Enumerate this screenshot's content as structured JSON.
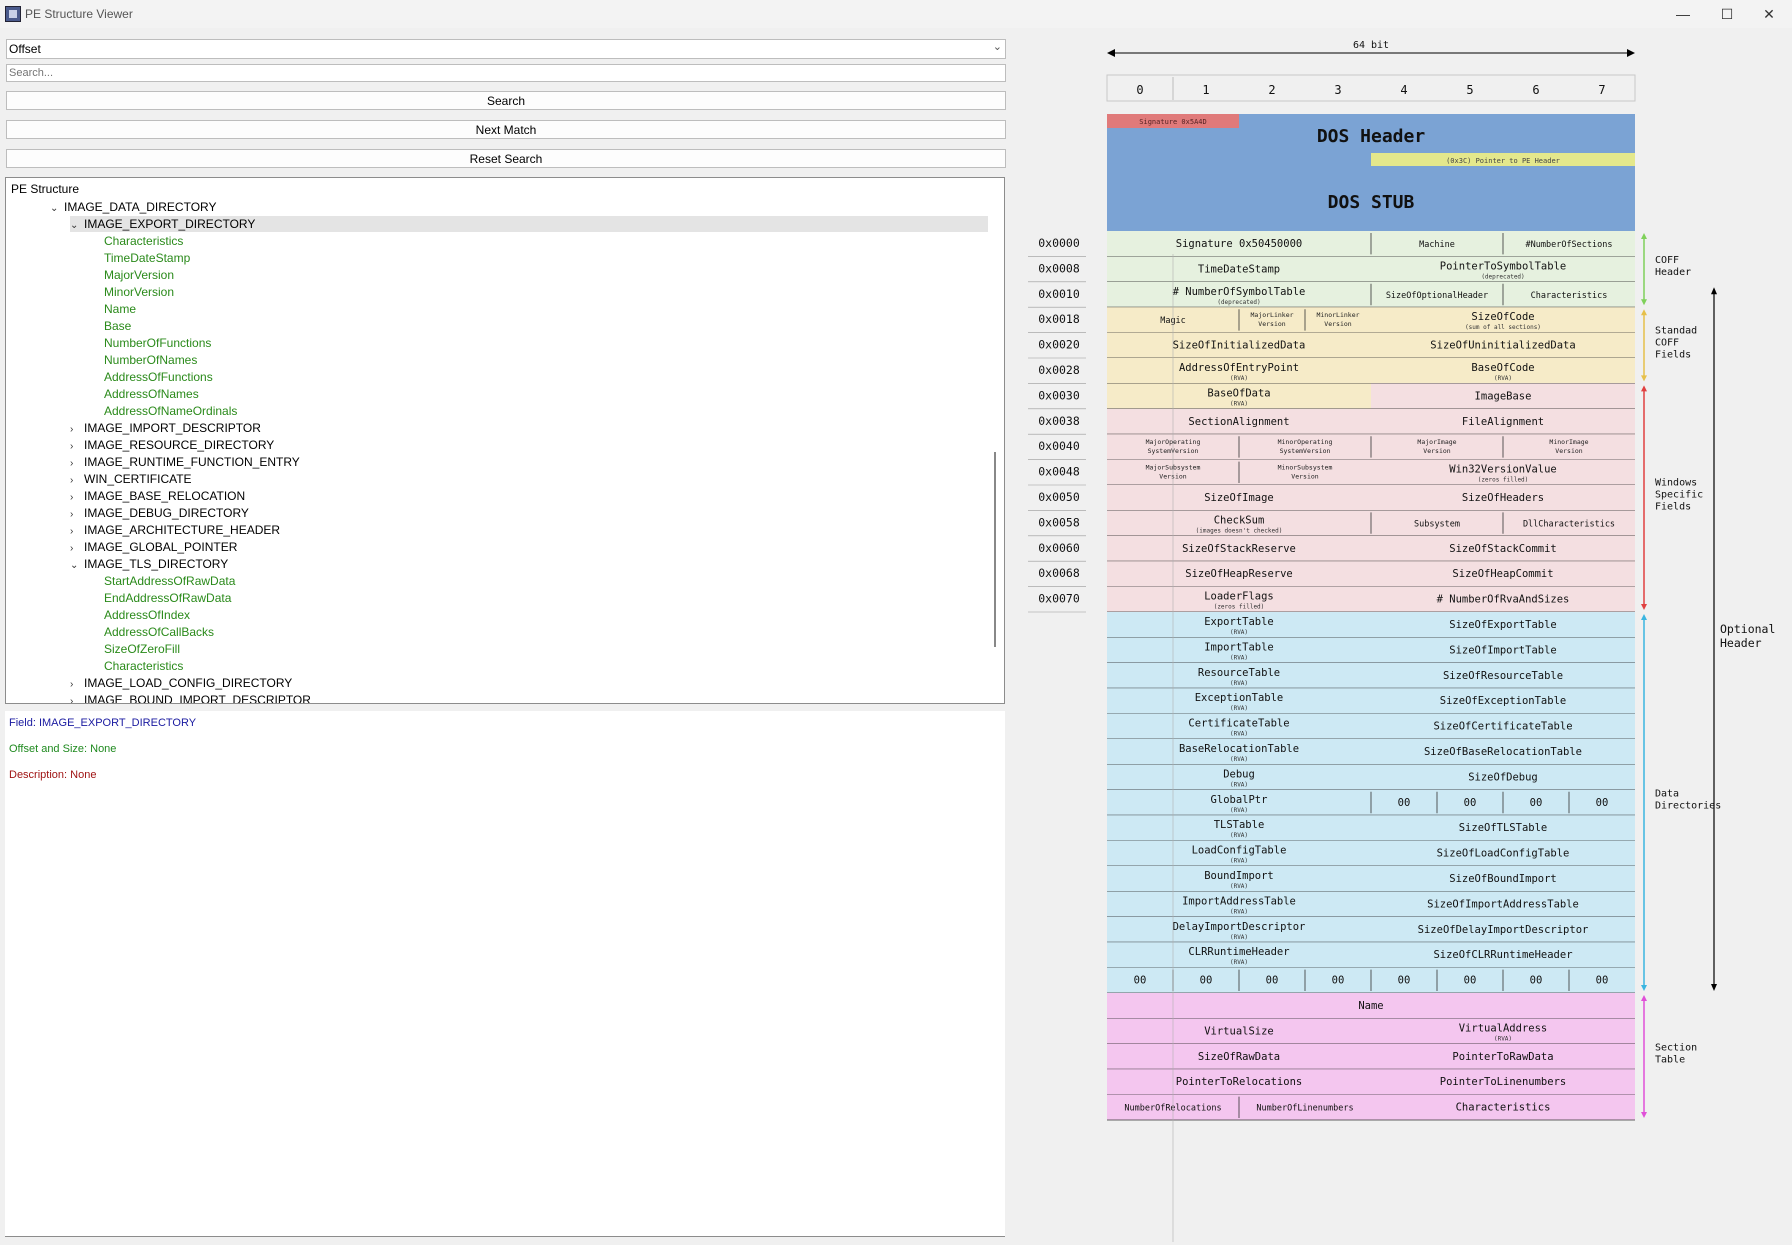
{
  "window": {
    "title": "PE Structure Viewer",
    "minimize": "—",
    "maximize": "☐",
    "close": "✕"
  },
  "combo": {
    "value": "Offset"
  },
  "search": {
    "placeholder": "Search...",
    "search_label": "Search",
    "next_label": "Next Match",
    "reset_label": "Reset Search"
  },
  "tree": {
    "root": "PE Structure",
    "rows": [
      {
        "label": "IMAGE_DATA_DIRECTORY",
        "level": 1,
        "arrow": "⌄",
        "leaf": false
      },
      {
        "label": "IMAGE_EXPORT_DIRECTORY",
        "level": 2,
        "arrow": "⌄",
        "leaf": false,
        "selected": true
      },
      {
        "label": "Characteristics",
        "level": 3,
        "arrow": "",
        "leaf": true
      },
      {
        "label": "TimeDateStamp",
        "level": 3,
        "arrow": "",
        "leaf": true
      },
      {
        "label": "MajorVersion",
        "level": 3,
        "arrow": "",
        "leaf": true
      },
      {
        "label": "MinorVersion",
        "level": 3,
        "arrow": "",
        "leaf": true
      },
      {
        "label": "Name",
        "level": 3,
        "arrow": "",
        "leaf": true
      },
      {
        "label": "Base",
        "level": 3,
        "arrow": "",
        "leaf": true
      },
      {
        "label": "NumberOfFunctions",
        "level": 3,
        "arrow": "",
        "leaf": true
      },
      {
        "label": "NumberOfNames",
        "level": 3,
        "arrow": "",
        "leaf": true
      },
      {
        "label": "AddressOfFunctions",
        "level": 3,
        "arrow": "",
        "leaf": true
      },
      {
        "label": "AddressOfNames",
        "level": 3,
        "arrow": "",
        "leaf": true
      },
      {
        "label": "AddressOfNameOrdinals",
        "level": 3,
        "arrow": "",
        "leaf": true
      },
      {
        "label": "IMAGE_IMPORT_DESCRIPTOR",
        "level": 2,
        "arrow": "›",
        "leaf": false
      },
      {
        "label": "IMAGE_RESOURCE_DIRECTORY",
        "level": 2,
        "arrow": "›",
        "leaf": false
      },
      {
        "label": "IMAGE_RUNTIME_FUNCTION_ENTRY",
        "level": 2,
        "arrow": "›",
        "leaf": false
      },
      {
        "label": "WIN_CERTIFICATE",
        "level": 2,
        "arrow": "›",
        "leaf": false
      },
      {
        "label": "IMAGE_BASE_RELOCATION",
        "level": 2,
        "arrow": "›",
        "leaf": false
      },
      {
        "label": "IMAGE_DEBUG_DIRECTORY",
        "level": 2,
        "arrow": "›",
        "leaf": false
      },
      {
        "label": "IMAGE_ARCHITECTURE_HEADER",
        "level": 2,
        "arrow": "›",
        "leaf": false
      },
      {
        "label": "IMAGE_GLOBAL_POINTER",
        "level": 2,
        "arrow": "›",
        "leaf": false
      },
      {
        "label": "IMAGE_TLS_DIRECTORY",
        "level": 2,
        "arrow": "⌄",
        "leaf": false
      },
      {
        "label": "StartAddressOfRawData",
        "level": 3,
        "arrow": "",
        "leaf": true
      },
      {
        "label": "EndAddressOfRawData",
        "level": 3,
        "arrow": "",
        "leaf": true
      },
      {
        "label": "AddressOfIndex",
        "level": 3,
        "arrow": "",
        "leaf": true
      },
      {
        "label": "AddressOfCallBacks",
        "level": 3,
        "arrow": "",
        "leaf": true
      },
      {
        "label": "SizeOfZeroFill",
        "level": 3,
        "arrow": "",
        "leaf": true
      },
      {
        "label": "Characteristics",
        "level": 3,
        "arrow": "",
        "leaf": true
      },
      {
        "label": "IMAGE_LOAD_CONFIG_DIRECTORY",
        "level": 2,
        "arrow": "›",
        "leaf": false
      },
      {
        "label": "IMAGE_BOUND_IMPORT_DESCRIPTOR",
        "level": 2,
        "arrow": "›",
        "leaf": false
      }
    ]
  },
  "details": {
    "field": "Field: IMAGE_EXPORT_DIRECTORY",
    "offset": "Offset and Size: None",
    "description": "Description: None",
    "field_color": "#1a1aa0",
    "offset_color": "#1f8a1f",
    "description_color": "#a01414"
  },
  "diagram": {
    "width_label": "64 bit",
    "columns": [
      "0",
      "1",
      "2",
      "3",
      "4",
      "5",
      "6",
      "7"
    ],
    "dos_header": "DOS Header",
    "dos_signature": "Signature 0x5A4D",
    "dos_pointer": "(0x3C) Pointer to PE Header",
    "dos_stub": "DOS STUB",
    "offsets": [
      "0x0000",
      "0x0008",
      "0x0010",
      "0x0018",
      "0x0020",
      "0x0028",
      "0x0030",
      "0x0038",
      "0x0040",
      "0x0048",
      "0x0050",
      "0x0058",
      "0x0060",
      "0x0068",
      "0x0070"
    ],
    "rows": [
      {
        "cells": [
          [
            "Signature 0x50450000",
            0,
            4,
            "m",
            ""
          ],
          [
            "Machine",
            4,
            6,
            "s",
            ""
          ],
          [
            "#NumberOfSections",
            6,
            8,
            "s",
            ""
          ]
        ]
      },
      {
        "cells": [
          [
            "TimeDateStamp",
            0,
            4,
            "m",
            ""
          ],
          [
            "PointerToSymbolTable",
            4,
            8,
            "m",
            "(deprecated)"
          ]
        ]
      },
      {
        "cells": [
          [
            "# NumberOfSymbolTable",
            0,
            4,
            "m",
            "(deprecated)"
          ],
          [
            "SizeOfOptionalHeader",
            4,
            6,
            "s",
            ""
          ],
          [
            "Characteristics",
            6,
            8,
            "s",
            ""
          ]
        ]
      },
      {
        "cells": [
          [
            "Magic",
            0,
            2,
            "s",
            ""
          ],
          [
            "MajorLinker Version",
            2,
            3,
            "xs",
            ""
          ],
          [
            "MinorLinker Version",
            3,
            4,
            "xs",
            ""
          ],
          [
            "SizeOfCode",
            4,
            8,
            "m",
            "(sum of all sections)"
          ]
        ]
      },
      {
        "cells": [
          [
            "SizeOfInitializedData",
            0,
            4,
            "m",
            ""
          ],
          [
            "SizeOfUninitializedData",
            4,
            8,
            "m",
            ""
          ]
        ]
      },
      {
        "cells": [
          [
            "AddressOfEntryPoint",
            0,
            4,
            "m",
            "(RVA)"
          ],
          [
            "BaseOfCode",
            4,
            8,
            "m",
            "(RVA)"
          ]
        ]
      },
      {
        "cells": [
          [
            "BaseOfData",
            0,
            4,
            "m",
            "(RVA)"
          ],
          [
            "ImageBase",
            4,
            8,
            "m",
            ""
          ]
        ]
      },
      {
        "cells": [
          [
            "SectionAlignment",
            0,
            4,
            "m",
            ""
          ],
          [
            "FileAlignment",
            4,
            8,
            "m",
            ""
          ]
        ]
      },
      {
        "cells": [
          [
            "MajorOperating SystemVersion",
            0,
            2,
            "xs",
            ""
          ],
          [
            "MinorOperating SystemVersion",
            2,
            4,
            "xs",
            ""
          ],
          [
            "MajorImage Version",
            4,
            6,
            "xs",
            ""
          ],
          [
            "MinorImage Version",
            6,
            8,
            "xs",
            ""
          ]
        ]
      },
      {
        "cells": [
          [
            "MajorSubsystem Version",
            0,
            2,
            "xs",
            ""
          ],
          [
            "MinorSubsystem Version",
            2,
            4,
            "xs",
            ""
          ],
          [
            "Win32VersionValue",
            4,
            8,
            "m",
            "(zeros filled)"
          ]
        ]
      },
      {
        "cells": [
          [
            "SizeOfImage",
            0,
            4,
            "m",
            ""
          ],
          [
            "SizeOfHeaders",
            4,
            8,
            "m",
            ""
          ]
        ]
      },
      {
        "cells": [
          [
            "CheckSum",
            0,
            4,
            "m",
            "(images doesn't checked)"
          ],
          [
            "Subsystem",
            4,
            6,
            "s",
            ""
          ],
          [
            "DllCharacteristics",
            6,
            8,
            "s",
            ""
          ]
        ]
      },
      {
        "cells": [
          [
            "SizeOfStackReserve",
            0,
            4,
            "m",
            ""
          ],
          [
            "SizeOfStackCommit",
            4,
            8,
            "m",
            ""
          ]
        ]
      },
      {
        "cells": [
          [
            "SizeOfHeapReserve",
            0,
            4,
            "m",
            ""
          ],
          [
            "SizeOfHeapCommit",
            4,
            8,
            "m",
            ""
          ]
        ]
      },
      {
        "cells": [
          [
            "LoaderFlags",
            0,
            4,
            "m",
            "(zeros filled)"
          ],
          [
            "# NumberOfRvaAndSizes",
            4,
            8,
            "m",
            ""
          ]
        ]
      },
      {
        "cells": [
          [
            "ExportTable",
            0,
            4,
            "m",
            "(RVA)"
          ],
          [
            "SizeOfExportTable",
            4,
            8,
            "m",
            ""
          ]
        ]
      },
      {
        "cells": [
          [
            "ImportTable",
            0,
            4,
            "m",
            "(RVA)"
          ],
          [
            "SizeOfImportTable",
            4,
            8,
            "m",
            ""
          ]
        ]
      },
      {
        "cells": [
          [
            "ResourceTable",
            0,
            4,
            "m",
            "(RVA)"
          ],
          [
            "SizeOfResourceTable",
            4,
            8,
            "m",
            ""
          ]
        ]
      },
      {
        "cells": [
          [
            "ExceptionTable",
            0,
            4,
            "m",
            "(RVA)"
          ],
          [
            "SizeOfExceptionTable",
            4,
            8,
            "m",
            ""
          ]
        ]
      },
      {
        "cells": [
          [
            "CertificateTable",
            0,
            4,
            "m",
            "(RVA)"
          ],
          [
            "SizeOfCertificateTable",
            4,
            8,
            "m",
            ""
          ]
        ]
      },
      {
        "cells": [
          [
            "BaseRelocationTable",
            0,
            4,
            "m",
            "(RVA)"
          ],
          [
            "SizeOfBaseRelocationTable",
            4,
            8,
            "m",
            ""
          ]
        ]
      },
      {
        "cells": [
          [
            "Debug",
            0,
            4,
            "m",
            "(RVA)"
          ],
          [
            "SizeOfDebug",
            4,
            8,
            "m",
            ""
          ]
        ]
      },
      {
        "cells": [
          [
            "GlobalPtr",
            0,
            4,
            "m",
            "(RVA)"
          ],
          [
            "00",
            4,
            5,
            "m",
            ""
          ],
          [
            "00",
            5,
            6,
            "m",
            ""
          ],
          [
            "00",
            6,
            7,
            "m",
            ""
          ],
          [
            "00",
            7,
            8,
            "m",
            ""
          ]
        ]
      },
      {
        "cells": [
          [
            "TLSTable",
            0,
            4,
            "m",
            "(RVA)"
          ],
          [
            "SizeOfTLSTable",
            4,
            8,
            "m",
            ""
          ]
        ]
      },
      {
        "cells": [
          [
            "LoadConfigTable",
            0,
            4,
            "m",
            "(RVA)"
          ],
          [
            "SizeOfLoadConfigTable",
            4,
            8,
            "m",
            ""
          ]
        ]
      },
      {
        "cells": [
          [
            "BoundImport",
            0,
            4,
            "m",
            "(RVA)"
          ],
          [
            "SizeOfBoundImport",
            4,
            8,
            "m",
            ""
          ]
        ]
      },
      {
        "cells": [
          [
            "ImportAddressTable",
            0,
            4,
            "m",
            "(RVA)"
          ],
          [
            "SizeOfImportAddressTable",
            4,
            8,
            "m",
            ""
          ]
        ]
      },
      {
        "cells": [
          [
            "DelayImportDescriptor",
            0,
            4,
            "m",
            "(RVA)"
          ],
          [
            "SizeOfDelayImportDescriptor",
            4,
            8,
            "m",
            ""
          ]
        ]
      },
      {
        "cells": [
          [
            "CLRRuntimeHeader",
            0,
            4,
            "m",
            "(RVA)"
          ],
          [
            "SizeOfCLRRuntimeHeader",
            4,
            8,
            "m",
            ""
          ]
        ]
      },
      {
        "cells": [
          [
            "00",
            0,
            1,
            "m",
            ""
          ],
          [
            "00",
            1,
            2,
            "m",
            ""
          ],
          [
            "00",
            2,
            3,
            "m",
            ""
          ],
          [
            "00",
            3,
            4,
            "m",
            ""
          ],
          [
            "00",
            4,
            5,
            "m",
            ""
          ],
          [
            "00",
            5,
            6,
            "m",
            ""
          ],
          [
            "00",
            6,
            7,
            "m",
            ""
          ],
          [
            "00",
            7,
            8,
            "m",
            ""
          ]
        ]
      },
      {
        "cells": [
          [
            "Name",
            0,
            8,
            "m",
            ""
          ]
        ]
      },
      {
        "cells": [
          [
            "VirtualSize",
            0,
            4,
            "m",
            ""
          ],
          [
            "VirtualAddress",
            4,
            8,
            "m",
            "(RVA)"
          ]
        ]
      },
      {
        "cells": [
          [
            "SizeOfRawData",
            0,
            4,
            "m",
            ""
          ],
          [
            "PointerToRawData",
            4,
            8,
            "m",
            ""
          ]
        ]
      },
      {
        "cells": [
          [
            "PointerToRelocations",
            0,
            4,
            "m",
            ""
          ],
          [
            "PointerToLinenumbers",
            4,
            8,
            "m",
            ""
          ]
        ]
      },
      {
        "cells": [
          [
            "NumberOfRelocations",
            0,
            2,
            "s",
            ""
          ],
          [
            "NumberOfLinenumbers",
            2,
            4,
            "s",
            ""
          ],
          [
            "Characteristics",
            4,
            8,
            "m",
            ""
          ]
        ]
      }
    ],
    "row_colors": [
      "coff",
      "coff",
      "coff",
      "std",
      "std",
      "std",
      "mix",
      "win",
      "win",
      "win",
      "win",
      "win",
      "win",
      "win",
      "win",
      "dd",
      "dd",
      "dd",
      "dd",
      "dd",
      "dd",
      "dd",
      "dd",
      "dd",
      "dd",
      "dd",
      "dd",
      "dd",
      "dd",
      "dd",
      "sec",
      "sec",
      "sec",
      "sec",
      "sec"
    ],
    "colors": {
      "dos": "#7ba3d4",
      "dos_sig": "#e07a7a",
      "dos_ptr": "#e4e88c",
      "coff": "#e6f1df",
      "std": "#f6ebc8",
      "win": "#f4dfe1",
      "dd": "#cde9f4",
      "sec": "#f4c6ef",
      "arrow_coff": "#7fd15a",
      "arrow_std": "#e6c04a",
      "arrow_win": "#e04040",
      "arrow_dd": "#3ab5e0",
      "arrow_sec": "#e050d8"
    },
    "groups": [
      {
        "label": "COFF Header",
        "lines": [
          "COFF",
          "Header"
        ]
      },
      {
        "label": "Standad COFF Fields",
        "lines": [
          "Standad",
          "COFF",
          "Fields"
        ]
      },
      {
        "label": "Windows Specific Fields",
        "lines": [
          "Windows",
          "Specific",
          "Fields"
        ]
      },
      {
        "label": "Data Directories",
        "lines": [
          "Data",
          "Directories"
        ]
      },
      {
        "label": "Section Table",
        "lines": [
          "Section",
          "Table"
        ]
      },
      {
        "label": "Optional Header",
        "lines": [
          "Optional",
          "Header"
        ]
      }
    ]
  }
}
